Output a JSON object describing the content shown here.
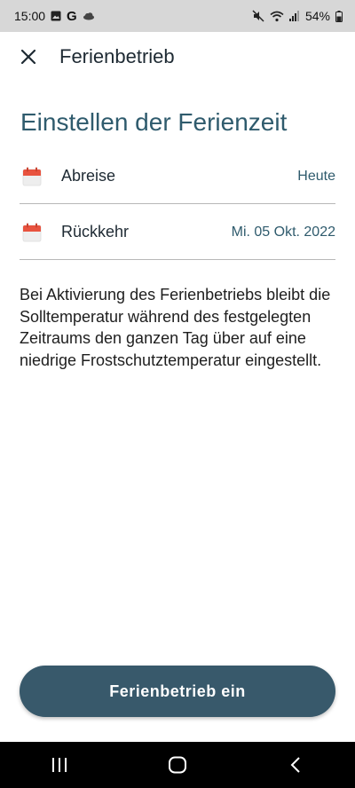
{
  "status_bar": {
    "time": "15:00",
    "battery": "54%",
    "icons_left": [
      "gallery-icon",
      "google-icon",
      "cloud-icon"
    ],
    "icons_right": [
      "mute-icon",
      "wifi-icon",
      "signal-icon",
      "battery-icon"
    ]
  },
  "app_bar": {
    "title": "Ferienbetrieb",
    "close_icon": "close-icon"
  },
  "section": {
    "heading": "Einstellen der Ferienzeit"
  },
  "rows": [
    {
      "label": "Abreise",
      "value": "Heute",
      "icon": "calendar-icon"
    },
    {
      "label": "Rückkehr",
      "value": "Mi. 05 Okt. 2022",
      "icon": "calendar-icon"
    }
  ],
  "description": "Bei Aktivierung des Ferienbetriebs bleibt die Solltemperatur während des festgelegten Zeitraums den ganzen Tag über auf eine niedrige Frostschutztemperatur eingestellt.",
  "primary_button": {
    "label": "Ferienbetrieb ein"
  },
  "nav_bar": {
    "buttons": [
      "recent-apps-icon",
      "home-icon",
      "back-icon"
    ]
  },
  "colors": {
    "accent": "#2f5b6d",
    "button": "#38596b",
    "calendar_red": "#e8533f"
  }
}
